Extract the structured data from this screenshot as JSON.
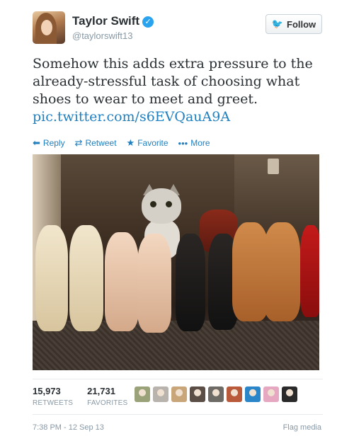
{
  "user": {
    "name": "Taylor Swift",
    "verified_mark": "✓",
    "handle": "@taylorswift13"
  },
  "follow_button": {
    "icon": "twitter-bird-icon",
    "label": "Follow"
  },
  "tweet": {
    "text": "Somehow this adds extra pressure to the already-stressful task of choosing what shoes to wear to meet and greet.",
    "link": "pic.twitter.com/s6EVQauA9A"
  },
  "actions": [
    {
      "icon": "reply-icon",
      "glyph": "⬅",
      "label": "Reply"
    },
    {
      "icon": "retweet-icon",
      "glyph": "⇄",
      "label": "Retweet"
    },
    {
      "icon": "star-icon",
      "glyph": "★",
      "label": "Favorite"
    },
    {
      "icon": "more-icon",
      "glyph": "•••",
      "label": "More"
    }
  ],
  "stats": {
    "retweets": {
      "value": "15,973",
      "label": "RETWEETS"
    },
    "favorites": {
      "value": "21,731",
      "label": "FAVORITES"
    }
  },
  "favoriter_avatar_colors": [
    "#9aa27a",
    "#b9b3ad",
    "#c9a57a",
    "#5a4e46",
    "#6e6a66",
    "#b95a3a",
    "#2a86c8",
    "#e6a8c0",
    "#2a2a2a"
  ],
  "footer": {
    "timestamp": "7:38 PM - 12 Sep 13",
    "flag_label": "Flag media"
  },
  "colors": {
    "accent": "#1f7fbf",
    "verified": "#2aa3ef",
    "muted": "#8899a6"
  }
}
